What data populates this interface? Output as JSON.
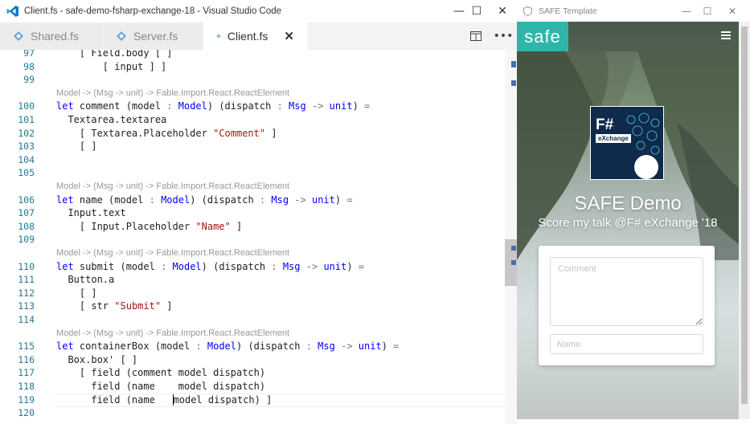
{
  "vscode": {
    "title": "Client.fs - safe-demo-fsharp-exchange-18 - Visual Studio Code",
    "window_controls": {
      "minimize": "—",
      "maximize": "☐",
      "close": "✕"
    },
    "tabs": [
      {
        "label": "Shared.fs"
      },
      {
        "label": "Server.fs"
      },
      {
        "label": "Client.fs",
        "active": true
      }
    ],
    "tab_close": "✕",
    "editor_actions": {
      "split": "split-editor-icon",
      "more": "•••"
    },
    "lines": [
      {
        "n": "97",
        "text": "    [ Field.body [ ]"
      },
      {
        "n": "98",
        "text": "        [ input ] ]"
      },
      {
        "n": "99",
        "text": ""
      },
      {
        "lens": "Model -> (Msg -> unit) -> Fable.Import.React.ReactElement"
      },
      {
        "n": "100",
        "text": "let comment (model : Model) (dispatch : Msg -> unit) ="
      },
      {
        "n": "101",
        "text": "  Textarea.textarea"
      },
      {
        "n": "102",
        "text": "    [ Textarea.Placeholder \"Comment\" ]"
      },
      {
        "n": "103",
        "text": "    [ ]"
      },
      {
        "n": "104",
        "text": ""
      },
      {
        "n": "105",
        "text": ""
      },
      {
        "lens": "Model -> (Msg -> unit) -> Fable.Import.React.ReactElement"
      },
      {
        "n": "106",
        "text": "let name (model : Model) (dispatch : Msg -> unit) ="
      },
      {
        "n": "107",
        "text": "  Input.text"
      },
      {
        "n": "108",
        "text": "    [ Input.Placeholder \"Name\" ]"
      },
      {
        "n": "109",
        "text": ""
      },
      {
        "lens": "Model -> (Msg -> unit) -> Fable.Import.React.ReactElement"
      },
      {
        "n": "110",
        "text": "let submit (model : Model) (dispatch : Msg -> unit) ="
      },
      {
        "n": "111",
        "text": "  Button.a"
      },
      {
        "n": "112",
        "text": "    [ ]"
      },
      {
        "n": "113",
        "text": "    [ str \"Submit\" ]"
      },
      {
        "n": "114",
        "text": ""
      },
      {
        "lens": "Model -> (Msg -> unit) -> Fable.Import.React.ReactElement"
      },
      {
        "n": "115",
        "text": "let containerBox (model : Model) (dispatch : Msg -> unit) ="
      },
      {
        "n": "116",
        "text": "  Box.box' [ ]"
      },
      {
        "n": "117",
        "text": "    [ field (comment model dispatch)"
      },
      {
        "n": "118",
        "text": "      field (name    model dispatch)"
      },
      {
        "n": "119",
        "text": "      field (name    model dispatch) ]"
      },
      {
        "n": "120",
        "text": ""
      }
    ]
  },
  "browser": {
    "title": "SAFE Template",
    "window_controls": {
      "minimize": "—",
      "maximize": "☐",
      "close": "✕"
    },
    "brand": "safe",
    "poster": {
      "line1": "F#",
      "line2": "eXchange"
    },
    "hero_title": "SAFE Demo",
    "hero_subtitle": "Score my talk @F# eXchange '18",
    "form": {
      "comment_placeholder": "Comment",
      "name_placeholder": "Name"
    }
  },
  "colors": {
    "keyword": "#0000ff",
    "string": "#a31515",
    "line_number": "#237893",
    "brand_teal": "#2fb5a8",
    "vscode_blue": "#007acc"
  }
}
